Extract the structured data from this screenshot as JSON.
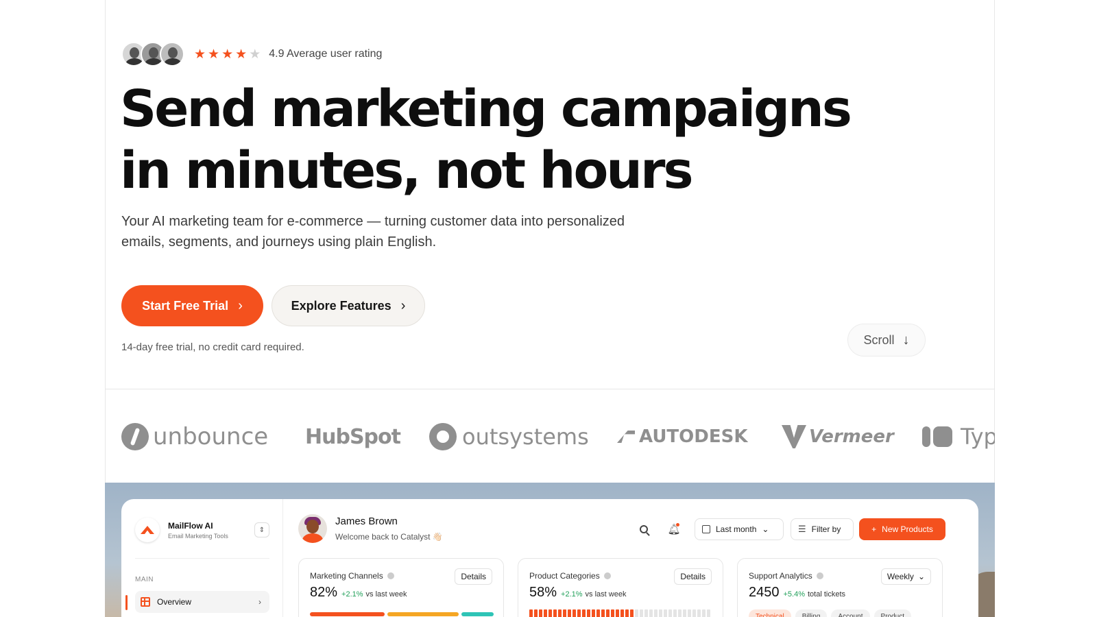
{
  "hero": {
    "rating_value": "4.9 Average user rating",
    "stars": [
      1,
      1,
      1,
      1,
      0
    ],
    "headline_line1": "Send marketing campaigns",
    "headline_line2": "in minutes, not hours",
    "subtext_line1": "Your AI marketing team for e-commerce — turning customer data into personalized",
    "subtext_line2": "emails, segments, and journeys using plain English.",
    "primary_cta": "Start Free Trial",
    "secondary_cta": "Explore Features",
    "trial_note": "14-day free trial, no credit card required.",
    "scroll_label": "Scroll"
  },
  "logos": [
    "unbounce",
    "HubSpot",
    "outsystems",
    "AUTODESK",
    "Vermeer",
    "Typ"
  ],
  "colors": {
    "accent": "#f4511e",
    "positive": "#22a05a"
  },
  "dashboard": {
    "brand": {
      "name": "MailFlow AI",
      "tagline": "Email Marketing Tools"
    },
    "sidebar": {
      "section": "MAIN",
      "items": [
        {
          "label": "Overview",
          "icon": "grid-icon"
        }
      ]
    },
    "user": {
      "name": "James Brown",
      "welcome": "Welcome back to Catalyst 👋🏻"
    },
    "controls": {
      "date_range": "Last month",
      "filter": "Filter by",
      "new_products": "New Products"
    },
    "cards": [
      {
        "title": "Marketing Channels",
        "button": "Details",
        "value": "82%",
        "delta": "+2.1%",
        "vs": "vs last week",
        "segments": [
          {
            "share": 0.42,
            "color": "#f4511e"
          },
          {
            "share": 0.4,
            "color": "#f5a623"
          },
          {
            "share": 0.18,
            "color": "#2ec4b6"
          }
        ]
      },
      {
        "title": "Product Categories",
        "button": "Details",
        "value": "58%",
        "delta": "+2.1%",
        "vs": "vs last week",
        "fill_fraction": 0.58
      },
      {
        "title": "Support Analytics",
        "button": "Weekly",
        "value": "2450",
        "delta": "+5.4%",
        "vs": "total tickets",
        "chips": [
          "Technical",
          "Billing",
          "Account",
          "Product"
        ]
      }
    ]
  }
}
